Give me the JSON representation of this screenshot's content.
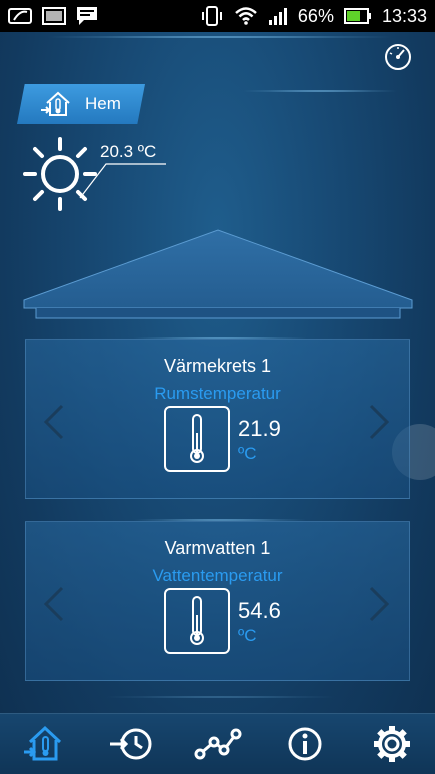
{
  "status_bar": {
    "battery_pct": "66%",
    "time": "13:33",
    "icons": [
      "leaf-icon",
      "image-icon",
      "message-icon",
      "vibrate-icon",
      "wifi-icon",
      "signal-icon",
      "battery-icon"
    ]
  },
  "header": {
    "gauge_icon": "gauge-icon",
    "home_tab_label": "Hem"
  },
  "weather": {
    "outdoor_temp": "20.3 ºC",
    "icon": "sun-icon"
  },
  "panels": [
    {
      "title": "Värmekrets 1",
      "subtitle": "Rumstemperatur",
      "value": "21.9",
      "unit": "ºC"
    },
    {
      "title": "Varmvatten 1",
      "subtitle": "Vattentemperatur",
      "value": "54.6",
      "unit": "ºC"
    }
  ],
  "bottom_nav": {
    "items": [
      "home-icon",
      "history-icon",
      "graph-icon",
      "info-icon",
      "settings-icon"
    ]
  },
  "colors": {
    "accent": "#2a9bf0",
    "tab": "#2f8ad3",
    "background": "#184b76"
  }
}
